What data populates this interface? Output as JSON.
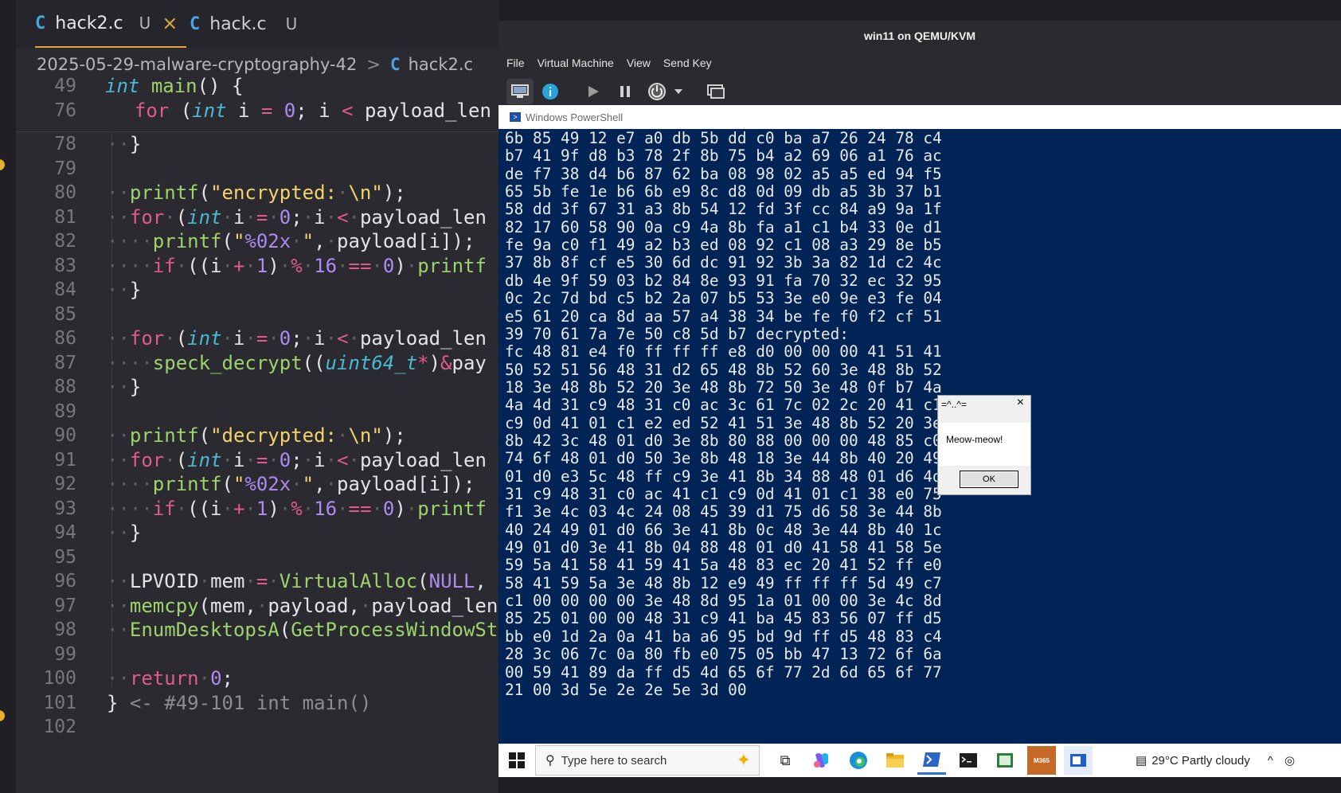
{
  "editor": {
    "tabs": [
      {
        "icon": "C",
        "label": "hack2.c",
        "status": "U",
        "close": "×"
      },
      {
        "icon": "C",
        "label": "hack.c",
        "status": "U"
      }
    ],
    "breadcrumb": {
      "folder": "2025-05-29-malware-cryptography-42",
      "sep": ">",
      "icon": "C",
      "file": "hack2.c"
    },
    "line_numbers": [
      "49",
      "76",
      "78",
      "79",
      "80",
      "81",
      "82",
      "83",
      "84",
      "85",
      "86",
      "87",
      "88",
      "89",
      "90",
      "91",
      "92",
      "93",
      "94",
      "95",
      "96",
      "97",
      "98",
      "99",
      "100",
      "101",
      "102"
    ]
  },
  "vm": {
    "title": "win11 on QEMU/KVM",
    "menu": [
      "File",
      "Virtual Machine",
      "View",
      "Send Key"
    ],
    "toolbar_icons": [
      "monitor-icon",
      "info-icon",
      "play-icon",
      "pause-icon",
      "power-icon",
      "dropdown-icon",
      "screens-icon"
    ],
    "powershell": {
      "title": "Windows PowerShell",
      "lines": [
        "6b 85 49 12 e7 a0 db 5b dd c0 ba a7 26 24 78 c4",
        "b7 41 9f d8 b3 78 2f 8b 75 b4 a2 69 06 a1 76 ac",
        "de f7 38 d4 b6 87 62 ba 08 98 02 a5 a5 ed 94 f5",
        "65 5b fe 1e b6 6b e9 8c d8 0d 09 db a5 3b 37 b1",
        "58 dd 3f 67 31 a3 8b 54 12 fd 3f cc 84 a9 9a 1f",
        "82 17 60 58 90 0a c9 4a 8b fa a1 c1 b4 33 0e d1",
        "fe 9a c0 f1 49 a2 b3 ed 08 92 c1 08 a3 29 8e b5",
        "37 8b 8f cf e5 30 6d dc 91 92 3b 3a 82 1d c2 4c",
        "db 4e 9f 59 03 b2 84 8e 93 91 fa 70 32 ec 32 95",
        "0c 2c 7d bd c5 b2 2a 07 b5 53 3e e0 9e e3 fe 04",
        "e5 61 20 ca 8d aa 57 a4 38 34 be fe f0 f2 cf 51",
        "39 70 61 7a 7e 50 c8 5d b7 decrypted:",
        "fc 48 81 e4 f0 ff ff ff e8 d0 00 00 00 41 51 41",
        "50 52 51 56 48 31 d2 65 48 8b 52 60 3e 48 8b 52",
        "18 3e 48 8b 52 20 3e 48 8b 72 50 3e 48 0f b7 4a",
        "4a 4d 31 c9 48 31 c0 ac 3c 61 7c 02 2c 20 41 c1",
        "c9 0d 41 01 c1 e2 ed 52 41 51 3e 48 8b 52 20 3e",
        "8b 42 3c 48 01 d0 3e 8b 80 88 00 00 00 48 85 c0",
        "74 6f 48 01 d0 50 3e 8b 48 18 3e 44 8b 40 20 49",
        "01 d0 e3 5c 48 ff c9 3e 41 8b 34 88 48 01 d6 4d",
        "31 c9 48 31 c0 ac 41 c1 c9 0d 41 01 c1 38 e0 75",
        "f1 3e 4c 03 4c 24 08 45 39 d1 75 d6 58 3e 44 8b",
        "40 24 49 01 d0 66 3e 41 8b 0c 48 3e 44 8b 40 1c",
        "49 01 d0 3e 41 8b 04 88 48 01 d0 41 58 41 58 5e",
        "59 5a 41 58 41 59 41 5a 48 83 ec 20 41 52 ff e0",
        "58 41 59 5a 3e 48 8b 12 e9 49 ff ff ff 5d 49 c7",
        "c1 00 00 00 00 3e 48 8d 95 1a 01 00 00 3e 4c 8d",
        "85 25 01 00 00 48 31 c9 41 ba 45 83 56 07 ff d5",
        "bb e0 1d 2a 0a 41 ba a6 95 bd 9d ff d5 48 83 c4",
        "28 3c 06 7c 0a 80 fb e0 75 05 bb 47 13 72 6f 6a",
        "00 59 41 89 da ff d5 4d 65 6f 77 2d 6d 65 6f 77",
        "21 00 3d 5e 2e 2e 5e 3d 00"
      ]
    },
    "messagebox": {
      "title": "=^..^=",
      "close": "×",
      "message": "Meow-meow!",
      "ok": "OK"
    },
    "taskbar": {
      "search_placeholder": "Type here to search",
      "weather": "29°C  Partly cloudy",
      "m365": "M365"
    }
  }
}
